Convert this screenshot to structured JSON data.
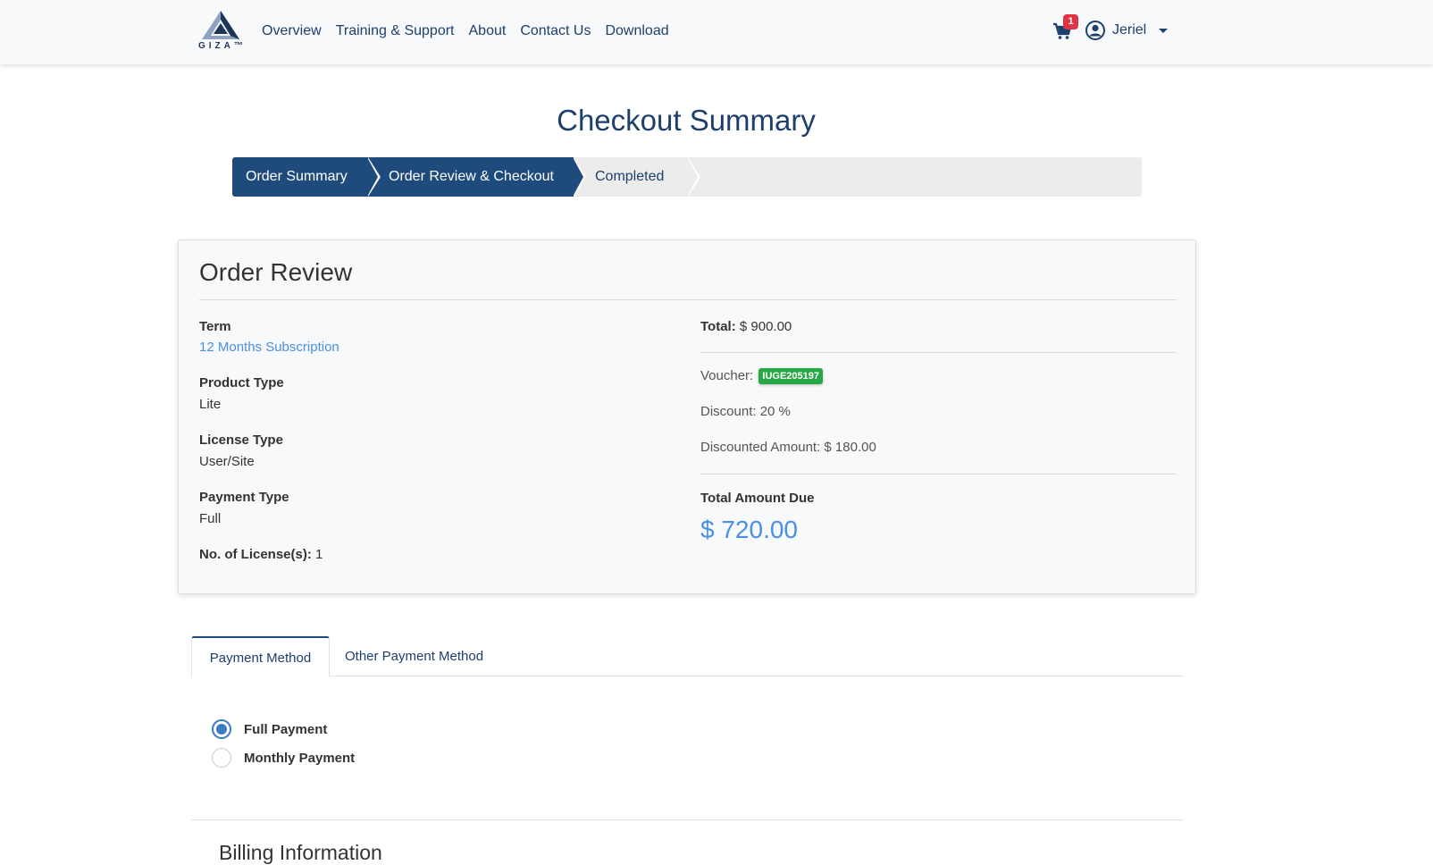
{
  "navbar": {
    "logo_text": "GIZA™",
    "links": [
      "Overview",
      "Training & Support",
      "About",
      "Contact Us",
      "Download"
    ],
    "cart_count": "1",
    "user_name": "Jeriel",
    "icons": {
      "cart": "shopping-cart-icon",
      "user": "user-circle-icon",
      "caret": "caret-down-icon"
    }
  },
  "page_title": "Checkout Summary",
  "steps": [
    "Order Summary",
    "Order Review & Checkout",
    "Completed"
  ],
  "active_step": 1,
  "order_review": {
    "title": "Order Review",
    "term_label": "Term",
    "term_value": "12 Months Subscription",
    "product_type_label": "Product Type",
    "product_type_value": "Lite",
    "license_type_label": "License Type",
    "license_type_value": "User/Site",
    "payment_type_label": "Payment Type",
    "payment_type_value": "Full",
    "licenses_label": "No. of License(s):",
    "licenses_value": "1",
    "total_label": "Total:",
    "total_value": "$ 900.00",
    "voucher_label": "Voucher:",
    "voucher_code": "IUGE205197",
    "discount_label": "Discount:",
    "discount_value": "20 %",
    "discounted_amount_label": "Discounted Amount:",
    "discounted_amount_value": "$ 180.00",
    "total_due_label": "Total Amount Due",
    "total_due_value": "$ 720.00"
  },
  "tabs": [
    "Payment Method",
    "Other Payment Method"
  ],
  "payment_options": [
    {
      "label": "Full Payment",
      "checked": true
    },
    {
      "label": "Monthly Payment",
      "checked": false
    }
  ],
  "billing_title": "Billing Information",
  "colors": {
    "primary": "#1f4a7c",
    "link": "#4a90e2",
    "badge_green": "#28a745",
    "badge_red": "#dc3545"
  }
}
